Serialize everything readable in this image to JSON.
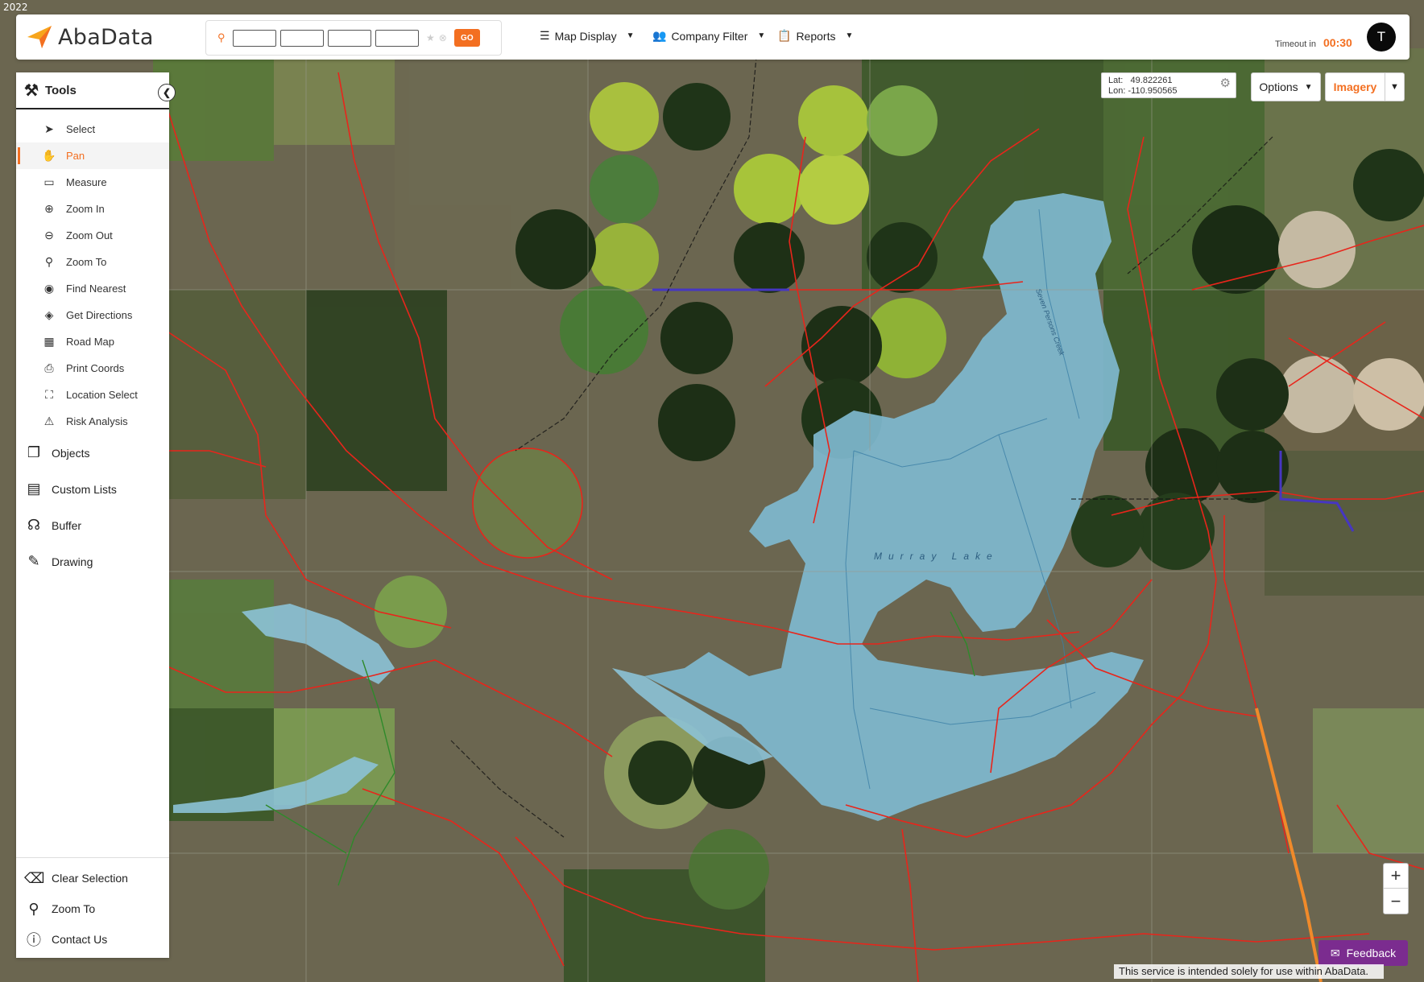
{
  "map": {
    "year": "2022",
    "lake_label": "Murray Lake",
    "creek_label": "Seven Persons Creek"
  },
  "header": {
    "app_name": "AbaData",
    "search_icon": "search-icon",
    "go_label": "GO",
    "menus": [
      {
        "label": "Map Display",
        "icon": "layers-icon"
      },
      {
        "label": "Company Filter",
        "icon": "people-icon"
      },
      {
        "label": "Reports",
        "icon": "clipboard-icon"
      }
    ],
    "timeout_label": "Timeout in",
    "timeout_value": "00:30",
    "avatar_initial": "T"
  },
  "sidebar": {
    "title": "Tools",
    "tools": [
      {
        "label": "Select",
        "icon": "pointer-icon",
        "active": false
      },
      {
        "label": "Pan",
        "icon": "hand-icon",
        "active": true
      },
      {
        "label": "Measure",
        "icon": "ruler-icon",
        "active": false
      },
      {
        "label": "Zoom In",
        "icon": "zoom-in-icon",
        "active": false
      },
      {
        "label": "Zoom Out",
        "icon": "zoom-out-icon",
        "active": false
      },
      {
        "label": "Zoom To",
        "icon": "zoom-to-icon",
        "active": false
      },
      {
        "label": "Find Nearest",
        "icon": "binoculars-icon",
        "active": false
      },
      {
        "label": "Get Directions",
        "icon": "directions-icon",
        "active": false
      },
      {
        "label": "Road Map",
        "icon": "map-icon",
        "active": false
      },
      {
        "label": "Print Coords",
        "icon": "printer-icon",
        "active": false
      },
      {
        "label": "Location Select",
        "icon": "location-select-icon",
        "active": false
      },
      {
        "label": "Risk Analysis",
        "icon": "warning-icon",
        "active": false
      }
    ],
    "sections": [
      {
        "label": "Objects",
        "icon": "objects-icon"
      },
      {
        "label": "Custom Lists",
        "icon": "list-icon"
      },
      {
        "label": "Buffer",
        "icon": "buffer-icon"
      },
      {
        "label": "Drawing",
        "icon": "pencil-icon"
      }
    ],
    "bottom": [
      {
        "label": "Clear Selection",
        "icon": "eraser-icon"
      },
      {
        "label": "Zoom To",
        "icon": "zoom-to-icon"
      },
      {
        "label": "Contact Us",
        "icon": "info-icon"
      }
    ]
  },
  "coords": {
    "lat_label": "Lat:",
    "lat_value": "49.822261",
    "lon_label": "Lon:",
    "lon_value": "-110.950565"
  },
  "controls": {
    "options_label": "Options",
    "imagery_label": "Imagery",
    "zoom_in": "+",
    "zoom_out": "−",
    "feedback_label": "Feedback",
    "disclaimer": "This service is intended solely for use within AbaData."
  },
  "colors": {
    "accent": "#f36f21",
    "feedback": "#7b2c8f",
    "lake": "#7fb8cf",
    "pipeline": "#e8251b"
  }
}
